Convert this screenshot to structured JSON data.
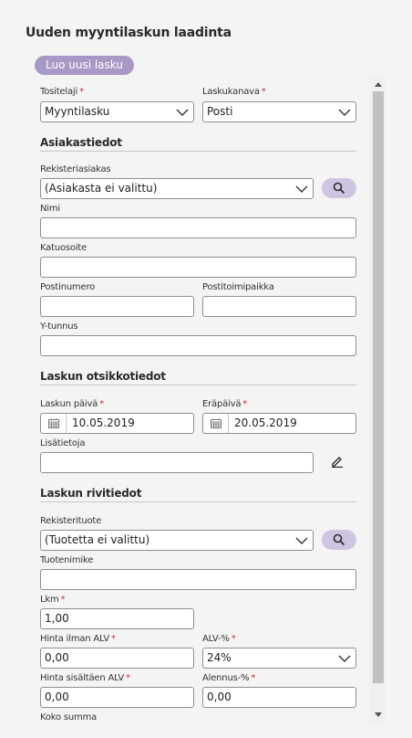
{
  "title": "Uuden myyntilaskun laadinta",
  "new_invoice_button": "Luo uusi lasku",
  "required_mark": "*",
  "fields": {
    "tositelaji": {
      "label": "Tositelaji",
      "value": "Myyntilasku"
    },
    "laskukanava": {
      "label": "Laskukanava",
      "value": "Posti"
    },
    "rekisteriasiakas": {
      "label": "Rekisteriasiakas",
      "value": "(Asiakasta ei valittu)"
    },
    "nimi": {
      "label": "Nimi",
      "value": ""
    },
    "katuosoite": {
      "label": "Katuosoite",
      "value": ""
    },
    "postinumero": {
      "label": "Postinumero",
      "value": ""
    },
    "postitoimipaikka": {
      "label": "Postitoimipaikka",
      "value": ""
    },
    "ytunnus": {
      "label": "Y-tunnus",
      "value": ""
    },
    "laskun_paiva": {
      "label": "Laskun päivä",
      "value": "10.05.2019"
    },
    "erapaiva": {
      "label": "Eräpäivä",
      "value": "20.05.2019"
    },
    "lisatietoja": {
      "label": "Lisätietoja",
      "value": ""
    },
    "rekisterituote": {
      "label": "Rekisterituote",
      "value": "(Tuotetta ei valittu)"
    },
    "tuotenimike": {
      "label": "Tuotenimike",
      "value": ""
    },
    "lkm": {
      "label": "Lkm",
      "value": "1,00"
    },
    "hinta_ilman_alv": {
      "label": "Hinta ilman ALV",
      "value": "0,00"
    },
    "alv": {
      "label": "ALV-%",
      "value": "24%"
    },
    "hinta_sis_alv": {
      "label": "Hinta sisältäen ALV",
      "value": "0,00"
    },
    "alennus": {
      "label": "Alennus-%",
      "value": "0,00"
    },
    "koko_summa": {
      "label": "Koko summa"
    }
  },
  "sections": {
    "asiakastiedot": "Asiakastiedot",
    "otsikkotiedot": "Laskun otsikkotiedot",
    "rivitiedot": "Laskun rivitiedot"
  },
  "icons": {
    "dropdown": "chevron-down-icon",
    "search": "search-icon",
    "calendar": "calendar-icon",
    "edit": "pencil-icon"
  },
  "colors": {
    "accent": "#a898c6",
    "search_button": "#cfc5e3",
    "required": "#c83232"
  }
}
